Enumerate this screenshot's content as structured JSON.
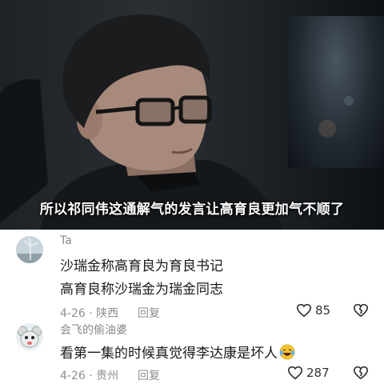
{
  "video": {
    "subtitle": "所以祁同伟这通解气的发言让高育良更加气不顺了"
  },
  "comments": [
    {
      "username": "Ta",
      "lines": [
        "沙瑞金称高育良为育良书记",
        "高育良称沙瑞金为瑞金同志"
      ],
      "date": "4-26",
      "location": "陕西",
      "reply_label": "回复",
      "likes": "85",
      "avatar_icon": "wind-turbine-avatar"
    },
    {
      "username": "会飞的偷油婆",
      "lines": [
        "看第一集的时候真觉得李达康是坏人"
      ],
      "emoji": "crying-laughing-emoji",
      "date": "4-26",
      "location": "贵州",
      "reply_label": "回复",
      "likes": "287",
      "avatar_icon": "cartoon-mouse-avatar"
    }
  ],
  "colors": {
    "secondary_text": "#8f8f8f",
    "primary_text": "#1a1a1a"
  }
}
